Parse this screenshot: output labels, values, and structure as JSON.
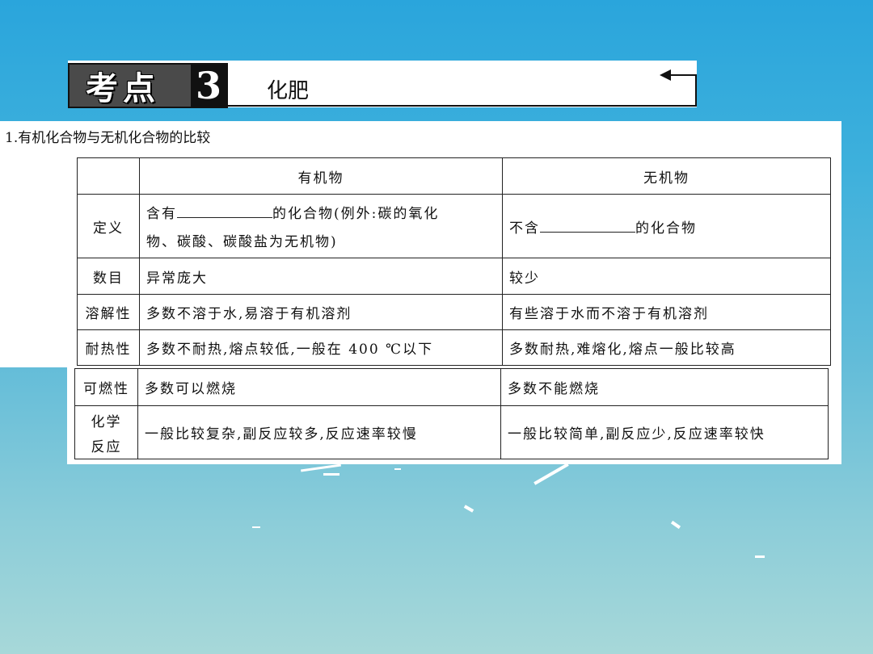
{
  "header": {
    "badge_text": "考点",
    "badge_number": "3",
    "title": "化肥"
  },
  "subtitle": "1.有机化合物与无机化合物的比较",
  "table": {
    "headers": [
      "",
      "有机物",
      "无机物"
    ],
    "rows": {
      "definition": {
        "label": "定义",
        "organic_before": "含有",
        "organic_after": "的化合物(例外:碳的氧化",
        "organic_line2": "物、碳酸、碳酸盐为无机物)",
        "inorganic_before": "不含",
        "inorganic_after": "的化合物"
      },
      "count": {
        "label": "数目",
        "organic": "异常庞大",
        "inorganic": "较少"
      },
      "solubility": {
        "label": "溶解性",
        "organic": "多数不溶于水,易溶于有机溶剂",
        "inorganic": "有些溶于水而不溶于有机溶剂"
      },
      "heat": {
        "label": "耐热性",
        "organic": "多数不耐热,熔点较低,一般在 400 ℃以下",
        "inorganic": "多数耐热,难熔化,熔点一般比较高"
      },
      "flammability": {
        "label": "可燃性",
        "organic": "多数可以燃烧",
        "inorganic": "多数不能燃烧"
      },
      "reaction": {
        "label_line1": "化学",
        "label_line2": "反应",
        "organic": "一般比较复杂,副反应较多,反应速率较慢",
        "inorganic": "一般比较简单,副反应少,反应速率较快"
      }
    }
  }
}
